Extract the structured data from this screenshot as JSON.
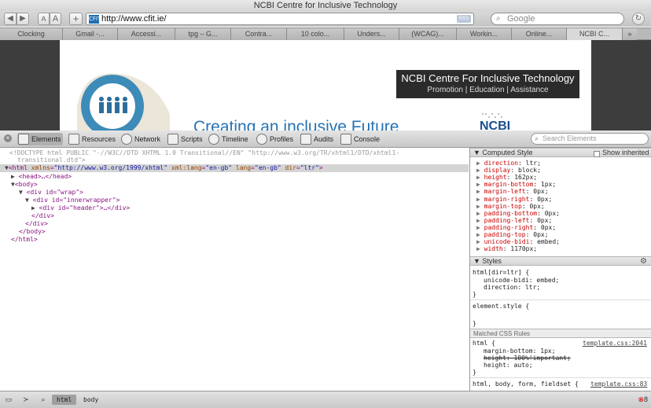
{
  "window": {
    "title": "NCBI Centre for Inclusive Technology"
  },
  "toolbar": {
    "back": "◀",
    "forward": "▶",
    "text_smaller": "A",
    "text_bigger": "A",
    "add_bookmark": "+",
    "favicon": "CFIT",
    "url": "http://www.cfit.ie/",
    "rss": "RSS",
    "search_placeholder": "Google",
    "reload": "↻"
  },
  "tabs": [
    {
      "label": "Clocking"
    },
    {
      "label": "Gmail -..."
    },
    {
      "label": "Accessi..."
    },
    {
      "label": "tpg – G..."
    },
    {
      "label": "Contra..."
    },
    {
      "label": "10 colo..."
    },
    {
      "label": "Unders..."
    },
    {
      "label": "(WCAG)..."
    },
    {
      "label": "Workin..."
    },
    {
      "label": "Online..."
    },
    {
      "label": "NCBI C..."
    }
  ],
  "tabs_more": "»",
  "page": {
    "banner_title": "NCBI Centre  For Inclusive Technology",
    "banner_sub": "Promotion | Education | Assistance",
    "tagline": "Creating an inclusive Future",
    "logo_text": "NCBI"
  },
  "devtools": {
    "tabs": [
      {
        "label": "Elements"
      },
      {
        "label": "Resources"
      },
      {
        "label": "Network"
      },
      {
        "label": "Scripts"
      },
      {
        "label": "Timeline"
      },
      {
        "label": "Profiles"
      },
      {
        "label": "Audits"
      },
      {
        "label": "Console"
      }
    ],
    "search_placeholder": "Search Elements",
    "dom": {
      "doctype1": "<!DOCTYPE html PUBLIC \"-//W3C//DTD XHTML 1.0 Transitional//EN\" \"http://www.w3.org/TR/xhtml1/DTD/xhtml1-",
      "doctype2": "transitional.dtd\">",
      "html_open_tag": "<html",
      "html_attr1_name": "xmlns",
      "html_attr1_val": "\"http://www.w3.org/1999/xhtml\"",
      "html_attr2_name": "xml:lang",
      "html_attr2_val": "\"en-gb\"",
      "html_attr3_name": "lang",
      "html_attr3_val": "\"en-gb\"",
      "html_attr4_name": "dir",
      "html_attr4_val": "\"ltr\"",
      "head": "<head>…</head>",
      "body_open": "<body>",
      "wrap_open": "<div id=\"wrap\">",
      "inner_open": "<div id=\"innerwrapper\">",
      "header": "<div id=\"header\">…</div>",
      "div_close1": "</div>",
      "div_close2": "</div>",
      "body_close": "</body>",
      "html_close": "</html>"
    },
    "computed": {
      "header": "Computed Style",
      "show_inherited": "Show inherited",
      "props": [
        {
          "name": "direction",
          "value": "ltr;"
        },
        {
          "name": "display",
          "value": "block;"
        },
        {
          "name": "height",
          "value": "162px;"
        },
        {
          "name": "margin-bottom",
          "value": "1px;"
        },
        {
          "name": "margin-left",
          "value": "0px;"
        },
        {
          "name": "margin-right",
          "value": "0px;"
        },
        {
          "name": "margin-top",
          "value": "0px;"
        },
        {
          "name": "padding-bottom",
          "value": "0px;"
        },
        {
          "name": "padding-left",
          "value": "0px;"
        },
        {
          "name": "padding-right",
          "value": "0px;"
        },
        {
          "name": "padding-top",
          "value": "0px;"
        },
        {
          "name": "unicode-bidi",
          "value": "embed;"
        },
        {
          "name": "width",
          "value": "1170px;"
        }
      ]
    },
    "styles": {
      "header": "Styles",
      "rule1_selector": "html[dir=ltr] {",
      "rule1_props": [
        "unicode-bidi: embed;",
        "direction: ltr;"
      ],
      "rule1_close": "}",
      "element_style": "element.style {",
      "element_close": "}",
      "matched_header": "Matched CSS Rules",
      "rule2_selector": "html {",
      "rule2_link": "template.css:2041",
      "rule2_props": [
        "margin-bottom: 1px;",
        "height: 100%!important;",
        "height: auto;"
      ],
      "rule2_close": "}",
      "rule3_selector": "html, body, form, fieldset {",
      "rule3_link": "template.css:83"
    },
    "status": {
      "crumbs": [
        "html",
        "body"
      ],
      "errors": "8"
    }
  },
  "colors": {
    "accent": "#2673b3",
    "selected_row": "#d4d4d4"
  }
}
